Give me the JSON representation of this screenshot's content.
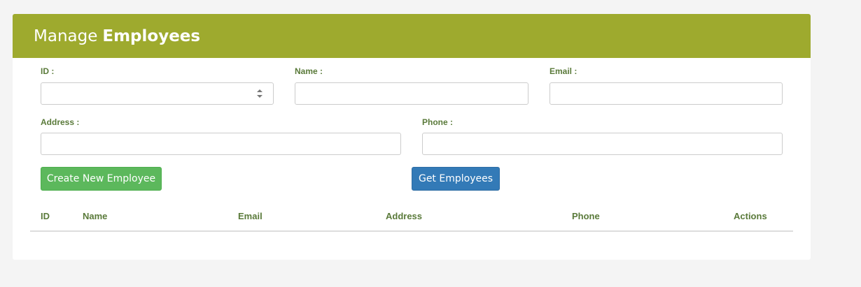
{
  "header": {
    "title_prefix": "Manage",
    "title_strong": "Employees",
    "background_color": "#9eaa2e"
  },
  "form": {
    "id_label": "ID :",
    "id_value": "",
    "name_label": "Name :",
    "name_value": "",
    "email_label": "Email :",
    "email_value": "",
    "address_label": "Address :",
    "address_value": "",
    "phone_label": "Phone :",
    "phone_value": ""
  },
  "buttons": {
    "create_label": "Create New Employee",
    "create_color": "#5cb85c",
    "get_label": "Get Employees",
    "get_color": "#337ab7"
  },
  "table": {
    "headers": [
      "ID",
      "Name",
      "Email",
      "Address",
      "Phone",
      "Actions"
    ],
    "rows": []
  },
  "icons": {
    "id_spinner": "spinner-arrows-icon"
  }
}
